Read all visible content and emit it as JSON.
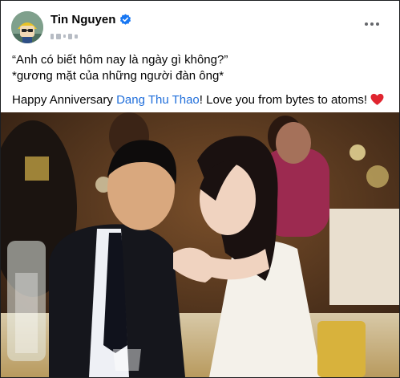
{
  "post": {
    "author_name": "Tin Nguyen",
    "text_line_1": "“Anh có biết hôm nay là ngày gì không?”",
    "text_line_2": "*gương mặt của những người đàn ông*",
    "text_line_3_prefix": "Happy Anniversary ",
    "mention": "Dang Thu Thao",
    "text_line_3_suffix": "! Love you from bytes to atoms! "
  },
  "icons": {
    "verified": "verified-badge-icon",
    "more": "more-options-icon",
    "heart": "red-heart-emoji-icon",
    "privacy": "redacted-meta"
  },
  "colors": {
    "link": "#216fdb",
    "verified": "#1877f2",
    "heart": "#e0252f"
  }
}
